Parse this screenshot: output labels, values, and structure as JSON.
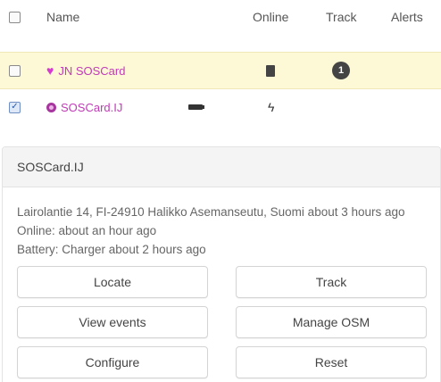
{
  "table": {
    "headers": {
      "name": "Name",
      "online": "Online",
      "track": "Track",
      "alerts": "Alerts"
    },
    "rows": [
      {
        "name": "JN SOSCard",
        "icon": "heart-icon",
        "checked": false,
        "online_icon": "phone-icon",
        "track_badge": "1"
      },
      {
        "name": "SOSCard.IJ",
        "icon": "gear-icon",
        "checked": true,
        "status_icon": "battery-icon",
        "online_icon": "bolt-icon"
      }
    ]
  },
  "panel": {
    "title": "SOSCard.IJ",
    "address_line": "Lairolantie 14, FI-24910 Halikko Asemanseutu, Suomi about 3 hours ago",
    "online_line": "Online: about an hour ago",
    "battery_line": "Battery: Charger about 2 hours ago",
    "buttons": {
      "locate": "Locate",
      "track": "Track",
      "view_events": "View events",
      "manage_osm": "Manage OSM",
      "configure": "Configure",
      "reset": "Reset"
    }
  },
  "colors": {
    "highlight_row": "#fdf8d5",
    "device_name": "#c23bb8",
    "panel_header": "#f4f4f4"
  }
}
